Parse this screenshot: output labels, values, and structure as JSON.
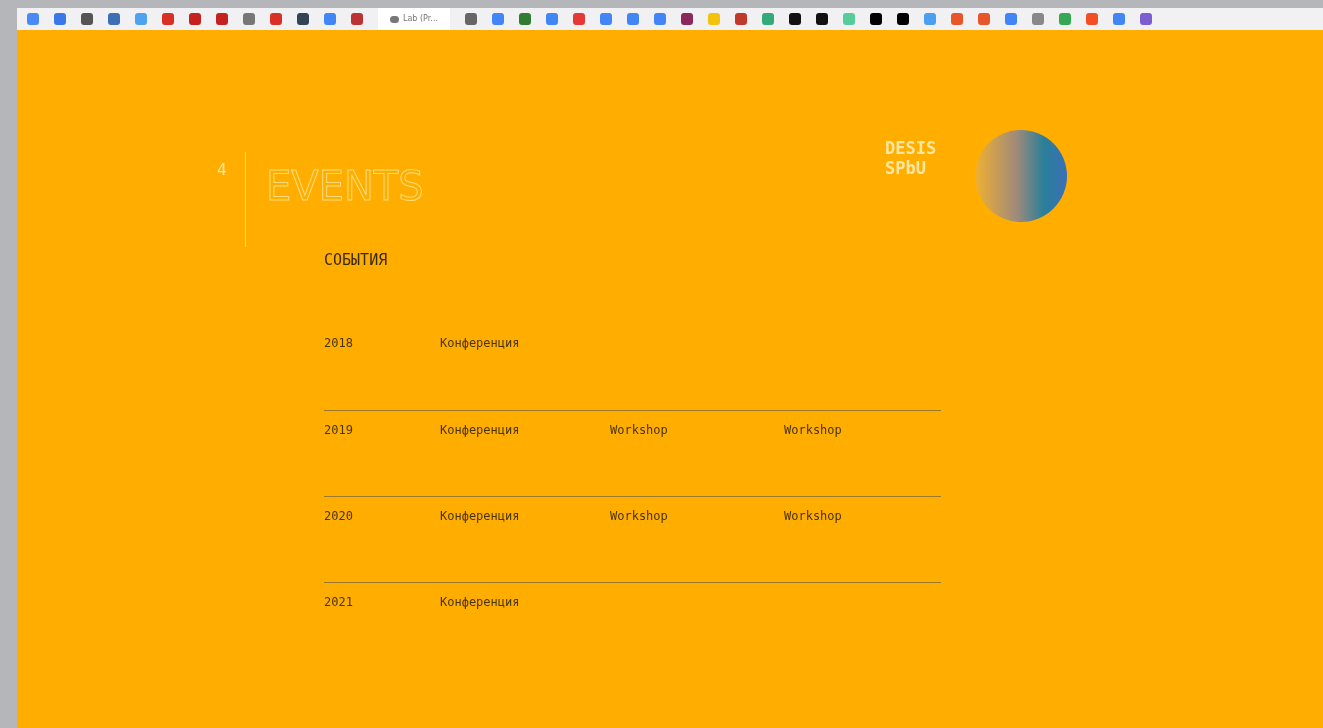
{
  "bookmarks_bar": {
    "tab_label": "Lab (Pr..."
  },
  "slide": {
    "number": "4",
    "title": "EVENTS",
    "subtitle": "СОБЫТИЯ",
    "logo_lines": [
      "DESIS",
      "SPbU"
    ],
    "rows": [
      {
        "year": "2018",
        "events": [
          "Конференция"
        ]
      },
      {
        "year": "2019",
        "events": [
          "Конференция",
          "Workshop",
          "Workshop"
        ]
      },
      {
        "year": "2020",
        "events": [
          "Конференция",
          "Workshop",
          "Workshop"
        ]
      },
      {
        "year": "2021",
        "events": [
          "Конференция"
        ]
      }
    ]
  }
}
